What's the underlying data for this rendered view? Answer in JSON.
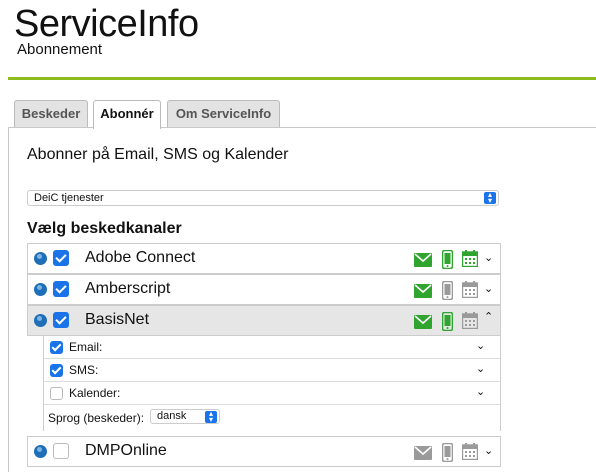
{
  "header": {
    "title": "ServiceInfo",
    "subtitle": "Abonnement"
  },
  "tabs": [
    {
      "label": "Beskeder",
      "active": false
    },
    {
      "label": "Abonnér",
      "active": true
    },
    {
      "label": "Om ServiceInfo",
      "active": false
    }
  ],
  "main": {
    "heading": "Abonner på Email, SMS og Kalender",
    "service_select": {
      "value": "DeiC tjenester"
    },
    "channels_title": "Vælg beskedkanaler"
  },
  "channels": [
    {
      "name": "Adobe Connect",
      "checked": true,
      "email": "active",
      "sms": "active",
      "calendar": "active",
      "expanded": false
    },
    {
      "name": "Amberscript",
      "checked": true,
      "email": "active",
      "sms": "inactive",
      "calendar": "inactive",
      "expanded": false
    },
    {
      "name": "BasisNet",
      "checked": true,
      "email": "active",
      "sms": "active",
      "calendar": "inactive",
      "expanded": true
    },
    {
      "name": "DMPOnline",
      "checked": false,
      "email": "inactive",
      "sms": "inactive",
      "calendar": "inactive",
      "expanded": false
    }
  ],
  "expanded_options": {
    "email_label": "Email:",
    "sms_label": "SMS:",
    "calendar_label": "Kalender:",
    "email_checked": true,
    "sms_checked": true,
    "calendar_checked": false,
    "language_label": "Sprog (beskeder):",
    "language_value": "dansk"
  },
  "colors": {
    "accent_green": "#8fbc1f",
    "active_icon": "#2fa52f",
    "inactive_icon": "#9a9a9a",
    "checkbox_blue": "#1a73e8"
  }
}
